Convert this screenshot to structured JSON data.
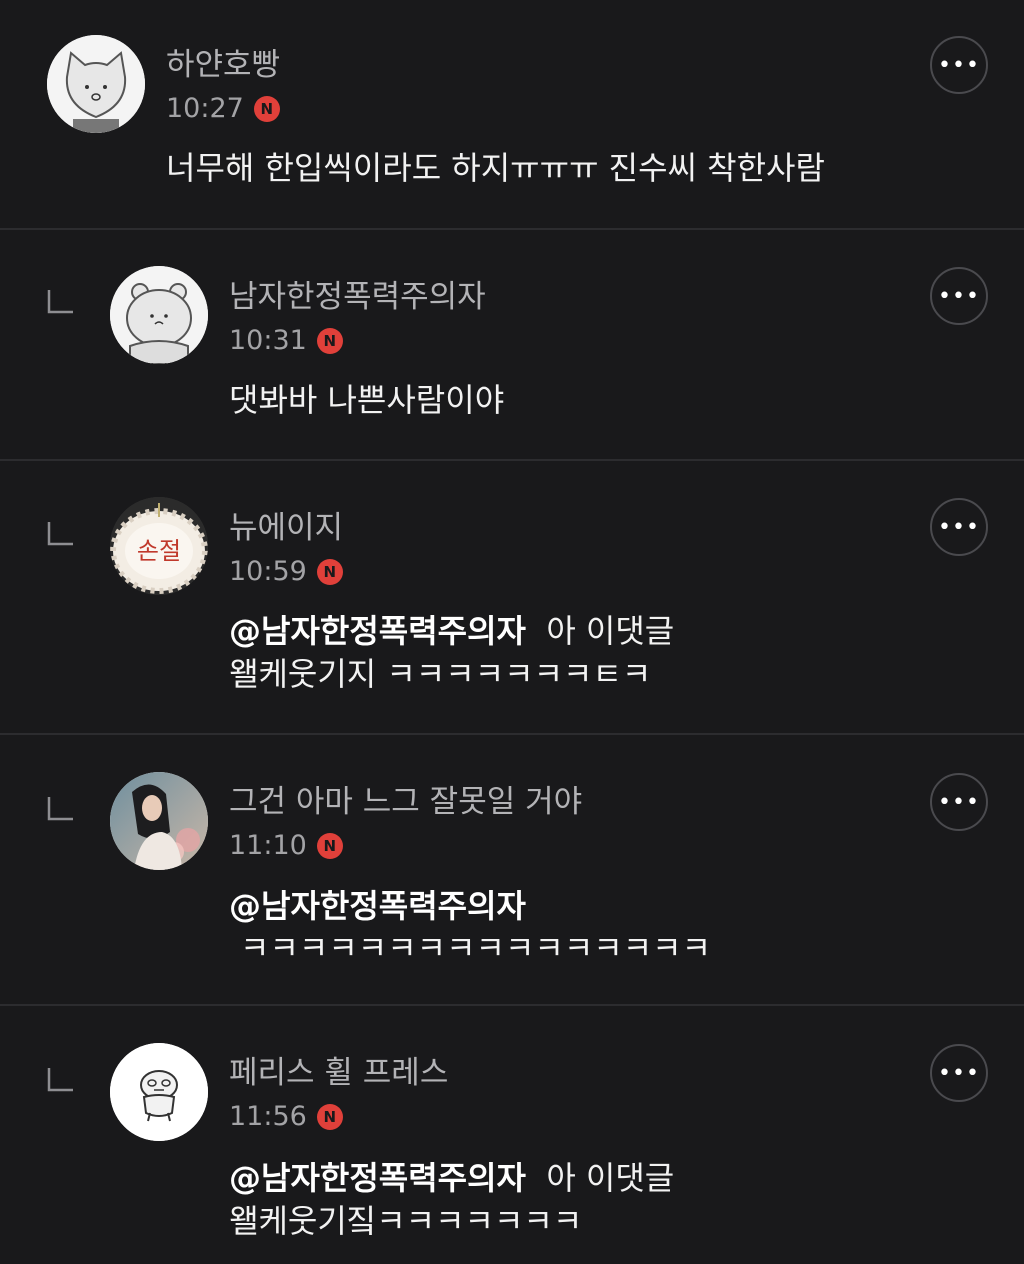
{
  "comments": [
    {
      "username": "하얀호빵",
      "time": "10:27",
      "badge": "N",
      "text": "너무해 한입씩이라도 하지ㅠㅠㅠ 진수씨 착한사람",
      "is_reply": false,
      "avatar_icon": "white-cat-avatar"
    },
    {
      "username": "남자한정폭력주의자",
      "time": "10:31",
      "badge": "N",
      "text": "댓봐바 나쁜사람이야",
      "is_reply": true,
      "avatar_icon": "white-bear-avatar"
    },
    {
      "username": "뉴에이지",
      "time": "10:59",
      "badge": "N",
      "mention": "@남자한정폭력주의자",
      "text_line1": "아 이댓글",
      "text_line2": "왤케웃기지 ㅋㅋㅋㅋㅋㅋㅋㅌㅋ",
      "is_reply": true,
      "avatar_icon": "cake-avatar",
      "avatar_text": "손절"
    },
    {
      "username": "그건 아마 느그 잘못일 거야",
      "time": "11:10",
      "badge": "N",
      "mention": "@남자한정폭력주의자",
      "text_line2": "ㅋㅋㅋㅋㅋㅋㅋㅋㅋㅋㅋㅋㅋㅋㅋㅋ",
      "is_reply": true,
      "avatar_icon": "woman-photo-avatar"
    },
    {
      "username": "페리스 휠 프레스",
      "time": "11:56",
      "badge": "N",
      "mention": "@남자한정폭력주의자",
      "text_line1": "아 이댓글",
      "text_line2": "왤케웃기짘ㅋㅋㅋㅋㅋㅋㅋ",
      "is_reply": true,
      "avatar_icon": "duck-avatar"
    }
  ],
  "more_label": "•••",
  "colors": {
    "background": "#19191b",
    "badge": "#e0403a",
    "divider": "#2c2c2f"
  }
}
